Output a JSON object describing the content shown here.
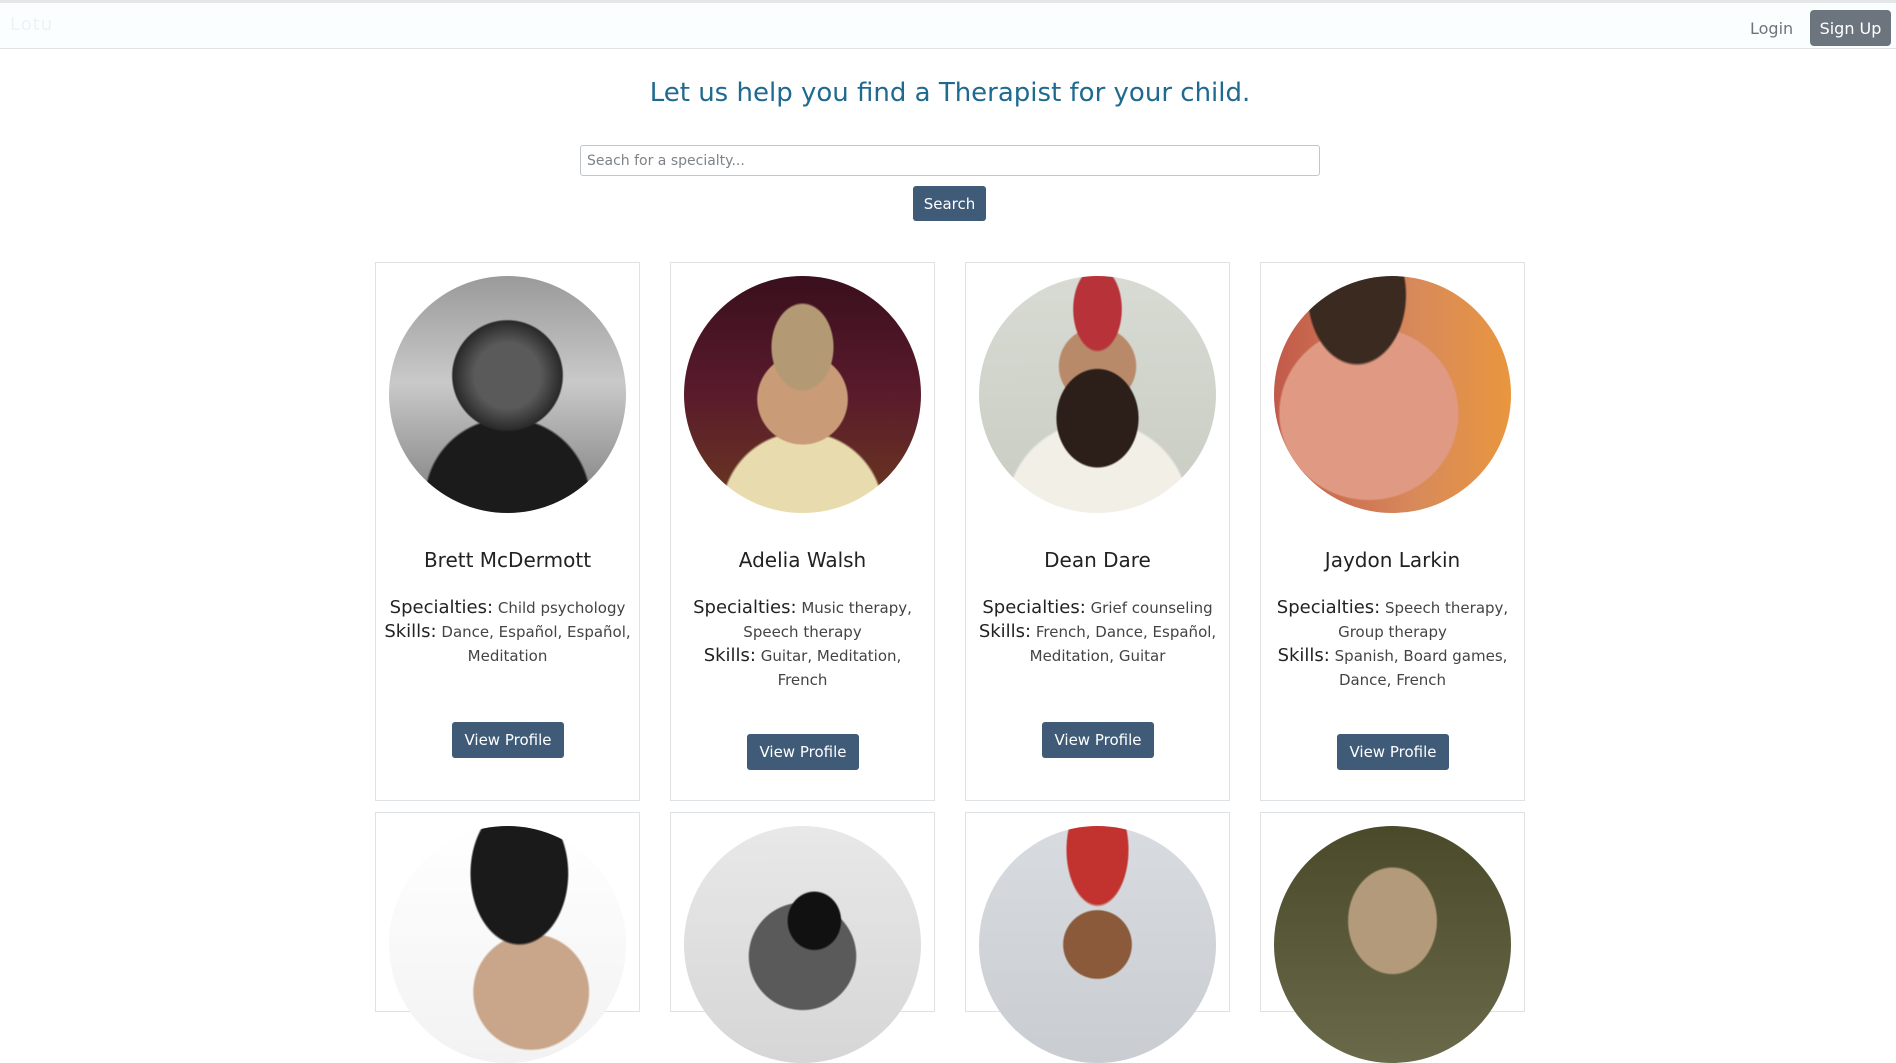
{
  "nav": {
    "brand": "Lotu",
    "login_label": "Login",
    "signup_label": "Sign Up"
  },
  "hero": {
    "headline": "Let us help you find a Therapist for your child."
  },
  "search": {
    "placeholder": "Seach for a specialty...",
    "value": "",
    "button_label": "Search"
  },
  "labels": {
    "specialties": "Specialties:",
    "skills": "Skills:",
    "view_profile": "View Profile"
  },
  "therapists": [
    {
      "name": "Brett McDermott",
      "specialties": "Child psychology",
      "skills": "Dance, Español, Español, Meditation"
    },
    {
      "name": "Adelia Walsh",
      "specialties": "Music therapy, Speech therapy",
      "skills": "Guitar, Meditation, French"
    },
    {
      "name": "Dean Dare",
      "specialties": "Grief counseling",
      "skills": "French, Dance, Español, Meditation, Guitar"
    },
    {
      "name": "Jaydon Larkin",
      "specialties": "Speech therapy, Group therapy",
      "skills": "Spanish, Board games, Dance, French"
    }
  ]
}
